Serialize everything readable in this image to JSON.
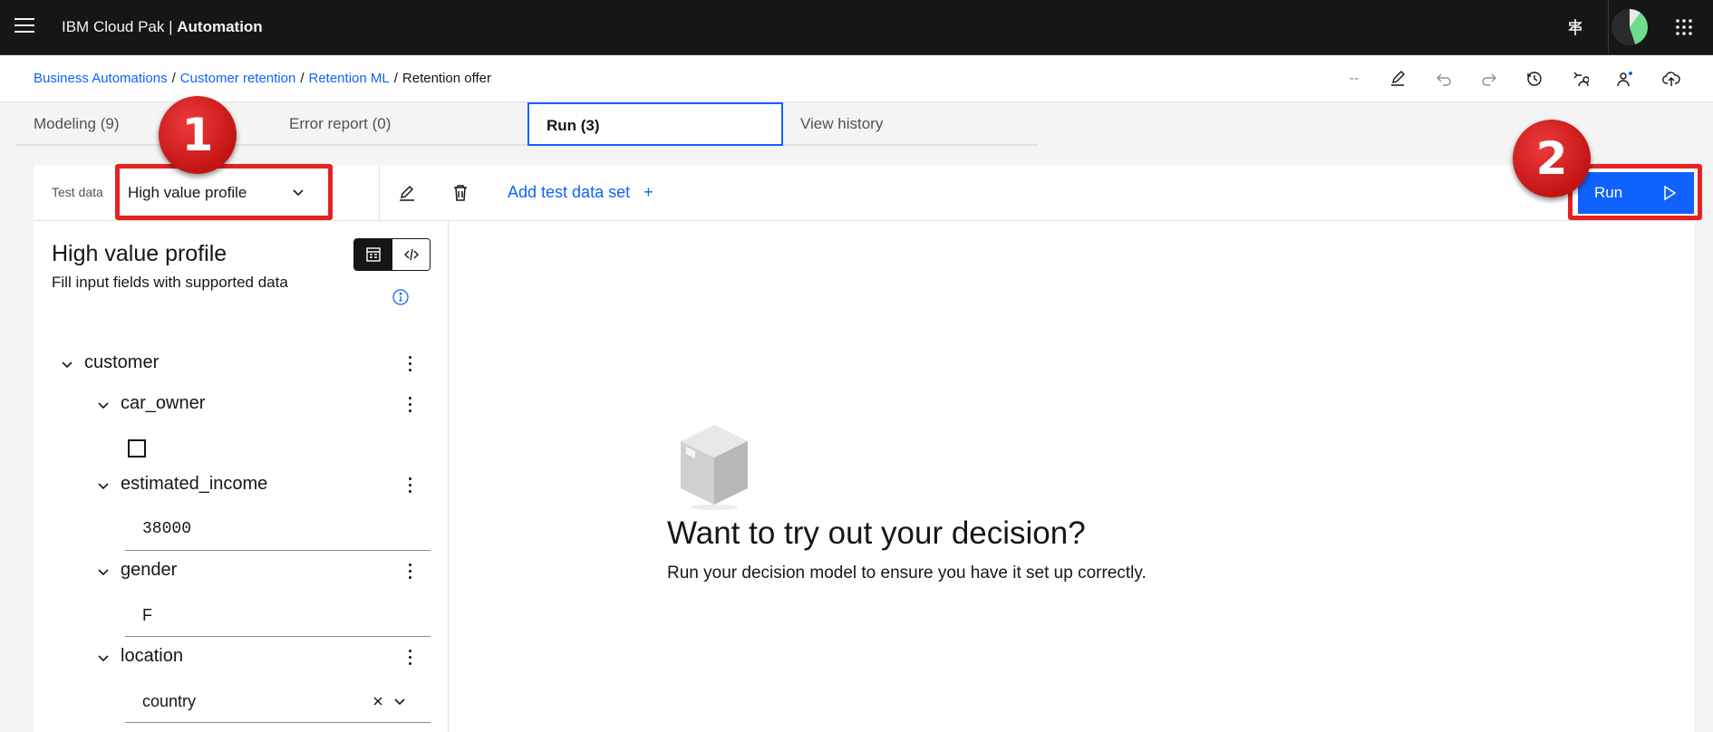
{
  "header": {
    "brand_prefix": "IBM Cloud Pak | ",
    "brand_bold": "Automation"
  },
  "toolbar": {
    "breadcrumb": [
      "Business Automations",
      "Customer retention",
      "Retention ML"
    ],
    "breadcrumb_current": "Retention offer",
    "separator": "/",
    "dashes": "--"
  },
  "tabs": [
    {
      "label": "Modeling (9)"
    },
    {
      "label": "Error report (0)"
    },
    {
      "label": "Run (3)"
    },
    {
      "label": "View history"
    }
  ],
  "testbar": {
    "label": "Test data",
    "selected": "High value profile",
    "add_label": "Add test data set",
    "add_plus": "+",
    "run_label": "Run"
  },
  "panel": {
    "title": "High value profile",
    "subtitle": "Fill input fields with supported data",
    "tree": {
      "root": "customer",
      "car_owner": "car_owner",
      "estimated_income": "estimated_income",
      "estimated_income_value": "38000",
      "gender": "gender",
      "gender_value": "F",
      "location": "location",
      "location_value": "country"
    }
  },
  "empty_state": {
    "title": "Want to try out your decision?",
    "subtitle": "Run your decision model to ensure you have it set up correctly."
  },
  "callouts": {
    "one": "1",
    "two": "2"
  },
  "colors": {
    "header_bg": "#161616",
    "accent": "#0f62fe",
    "callout": "#e52222"
  }
}
